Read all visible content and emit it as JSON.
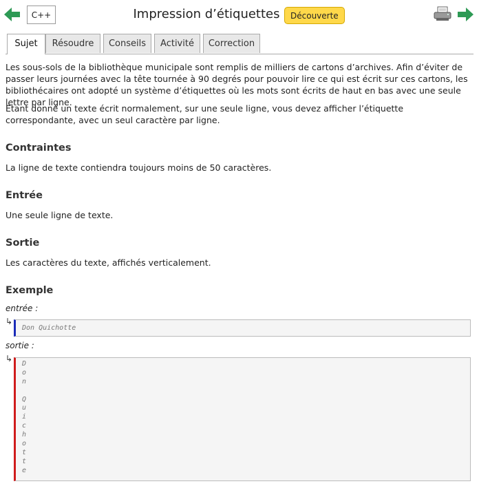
{
  "header": {
    "language": "C++",
    "title": "Impression d’étiquettes",
    "badge": "Découverte",
    "colors": {
      "arrow": "#2e9a55",
      "badge": "#ffd84a"
    },
    "icons": [
      "arrow-left-icon",
      "arrow-right-icon",
      "printer-icon"
    ]
  },
  "tabs": [
    {
      "label": "Sujet",
      "active": true
    },
    {
      "label": "Résoudre"
    },
    {
      "label": "Conseils"
    },
    {
      "label": "Activité"
    },
    {
      "label": "Correction"
    }
  ],
  "statement": {
    "paragraph1": "Les sous-sols de la bibliothèque municipale sont remplis de milliers de cartons d’archives. Afin d’éviter de passer leurs journées avec la tête tournée à 90 degrés pour pouvoir lire ce qui est écrit sur ces cartons, les bibliothécaires ont adopté un système d’étiquettes où les mots sont écrits de haut en bas avec une seule lettre par ligne.",
    "paragraph2": "Étant donné un texte écrit normalement, sur une seule ligne, vous devez afficher l’étiquette correspondante, avec un seul caractère par ligne."
  },
  "sections": {
    "constraints_title": "Contraintes",
    "constraints_text": "La ligne de texte contiendra toujours moins de 50 caractères.",
    "input_title": "Entrée",
    "input_text": "Une seule ligne de texte.",
    "output_title": "Sortie",
    "output_text": "Les caractères du texte, affichés verticalement.",
    "example_title": "Exemple"
  },
  "example": {
    "input_label": "entrée :",
    "input_value": "Don Quichotte",
    "output_label": "sortie :",
    "output_lines": [
      "D",
      "o",
      "n",
      "",
      "Q",
      "u",
      "i",
      "c",
      "h",
      "o",
      "t",
      "t",
      "e"
    ],
    "arrow_glyph": "↳"
  }
}
